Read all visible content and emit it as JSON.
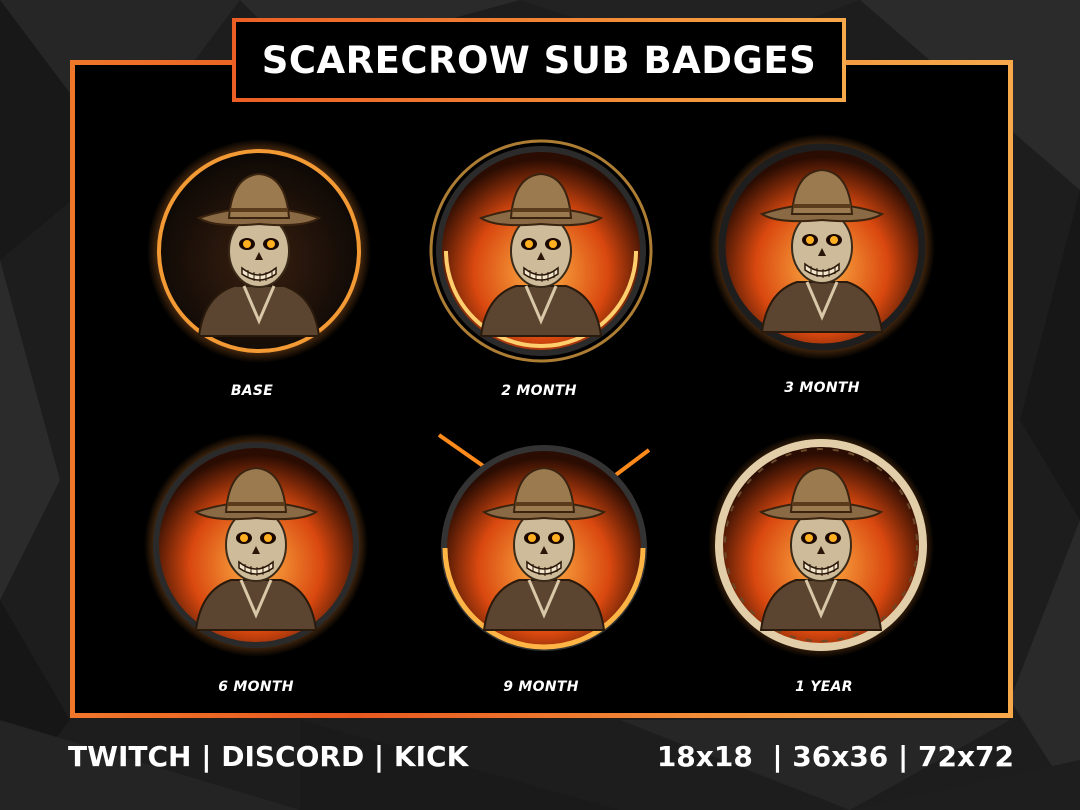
{
  "title": "SCARECROW SUB BADGES",
  "colors": {
    "accent_orange": "#f0762a",
    "accent_gold": "#f7a84a",
    "panel_bg": "#000000",
    "page_bg": "#1c1c1c"
  },
  "badges": [
    {
      "label": "BASE",
      "icon": "scarecrow-icon"
    },
    {
      "label": "2 MONTH",
      "icon": "scarecrow-icon"
    },
    {
      "label": "3 MONTH",
      "icon": "scarecrow-icon"
    },
    {
      "label": "6 MONTH",
      "icon": "scarecrow-icon"
    },
    {
      "label": "9 MONTH",
      "icon": "scarecrow-icon"
    },
    {
      "label": "1 YEAR",
      "icon": "scarecrow-icon"
    }
  ],
  "footer": {
    "platforms": "TWITCH | DISCORD | KICK",
    "sizes": "18x18  | 36x36 | 72x72"
  }
}
